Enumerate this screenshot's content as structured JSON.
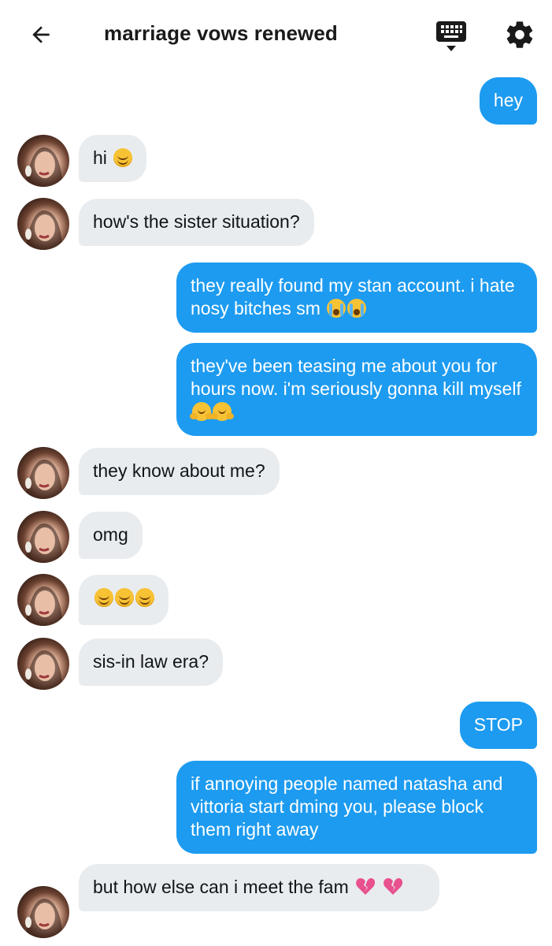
{
  "header": {
    "back_icon": "arrow-left-icon",
    "title": "marriage vows renewed",
    "keyboard_icon": "keyboard-icon",
    "settings_icon": "gear-icon"
  },
  "colors": {
    "sent_bubble": "#1d9bf0",
    "received_bubble": "#e9ecef",
    "sent_text": "#ffffff",
    "received_text": "#111418"
  },
  "messages": [
    {
      "from": "me",
      "text": "hey",
      "emoji": []
    },
    {
      "from": "them",
      "text": "hi",
      "emoji": [
        "smiling-face"
      ]
    },
    {
      "from": "them",
      "text": "how's the sister situation?",
      "emoji": []
    },
    {
      "from": "me",
      "text": "they really found my stan account. i hate nosy bitches sm",
      "emoji": [
        "loudly-crying-face",
        "loudly-crying-face"
      ]
    },
    {
      "from": "me",
      "text": "they've been teasing me about you for hours now. i'm seriously gonna kill myself",
      "emoji": [
        "hugging-face",
        "hugging-face"
      ]
    },
    {
      "from": "them",
      "text": "they know about me?",
      "emoji": []
    },
    {
      "from": "them",
      "text": "omg",
      "emoji": []
    },
    {
      "from": "them",
      "text": "",
      "emoji": [
        "smiling-face",
        "smiling-face",
        "smiling-face"
      ]
    },
    {
      "from": "them",
      "text": "sis-in law era?",
      "emoji": []
    },
    {
      "from": "me",
      "text": "STOP",
      "emoji": []
    },
    {
      "from": "me",
      "text": "if annoying people named natasha and vittoria start dming you, please block them right away",
      "emoji": []
    },
    {
      "from": "them",
      "text": "but how else can i meet the fam",
      "emoji": [
        "broken-heart",
        "broken-heart"
      ]
    }
  ]
}
